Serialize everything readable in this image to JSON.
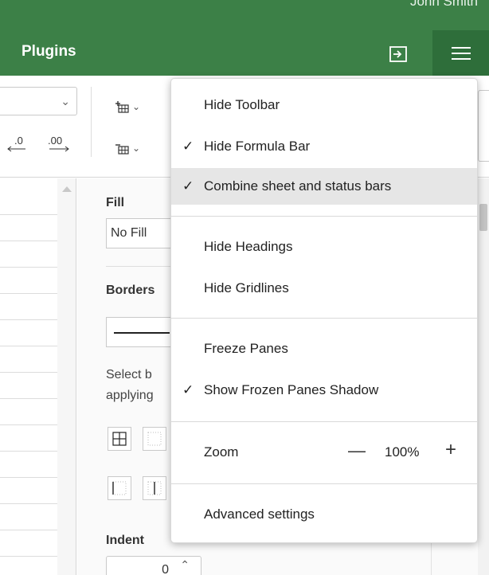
{
  "header": {
    "user_name": "John Smith",
    "plugins_label": "Plugins",
    "exit_icon": "exit-fullscreen-icon",
    "menu_icon": "hamburger-menu-icon",
    "background_color": "#3c8047"
  },
  "toolbar": {
    "decrease_decimal_label": ".0",
    "increase_decimal_label": ".00",
    "chevron_glyph": "⌄"
  },
  "format_panel": {
    "fill_title": "Fill",
    "fill_value": "No Fill",
    "borders_title": "Borders",
    "borders_hint_line1": "Select b",
    "borders_hint_line2": "applying",
    "indent_title": "Indent",
    "indent_value": "0"
  },
  "view_menu": {
    "items": [
      {
        "label": "Hide Toolbar",
        "checked": false
      },
      {
        "label": "Hide Formula Bar",
        "checked": true
      },
      {
        "label": "Combine sheet and status bars",
        "checked": true,
        "highlighted": true
      },
      {
        "label": "Hide Headings",
        "checked": false
      },
      {
        "label": "Hide Gridlines",
        "checked": false
      },
      {
        "label": "Freeze Panes",
        "checked": false
      },
      {
        "label": "Show Frozen Panes Shadow",
        "checked": true
      },
      {
        "label": "Advanced settings",
        "checked": false
      }
    ],
    "check_glyph": "✓",
    "zoom": {
      "label": "Zoom",
      "minus": "—",
      "value": "100%",
      "plus": "+"
    }
  }
}
